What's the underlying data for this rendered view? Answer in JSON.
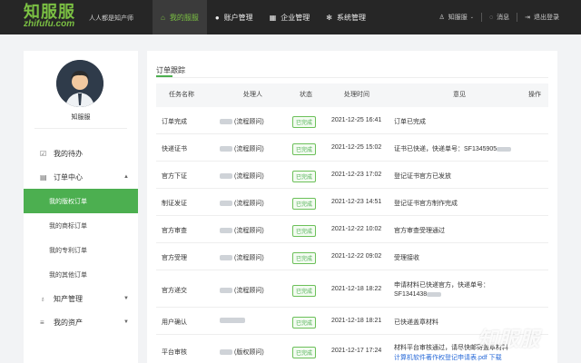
{
  "brand": {
    "logo_big": "知服服",
    "logo_small": "zhifufu.com",
    "slogan": "人人都是知产师"
  },
  "nav": [
    {
      "label": "我的服服",
      "icon": "home-icon",
      "active": true
    },
    {
      "label": "账户管理",
      "icon": "user-icon",
      "active": false
    },
    {
      "label": "企业管理",
      "icon": "building-icon",
      "active": false
    },
    {
      "label": "系统管理",
      "icon": "gear-icon",
      "active": false
    }
  ],
  "topright": {
    "user": "知服服",
    "messages": "消息",
    "logout": "退出登录"
  },
  "sidebar": {
    "username": "知服服",
    "items": [
      {
        "label": "我的待办",
        "icon": "todo-icon"
      },
      {
        "label": "订单中心",
        "icon": "order-icon",
        "expanded": true
      }
    ],
    "subitems": [
      "我的版权订单",
      "我的商标订单",
      "我的专利订单",
      "我的其他订单"
    ],
    "bottom_items": [
      {
        "label": "知产管理",
        "icon": "bulb-icon"
      },
      {
        "label": "我的资产",
        "icon": "database-icon"
      }
    ]
  },
  "main": {
    "title": "订单跟踪",
    "headers": [
      "任务名称",
      "处理人",
      "状态",
      "处理时间",
      "意见",
      "操作"
    ],
    "rows": [
      {
        "task": "订单完成",
        "handler": "(流程顾问)",
        "status": "已完成",
        "time": "2021-12-25 16:41",
        "opinion": "订单已完成",
        "opinion2": "",
        "link": ""
      },
      {
        "task": "快递证书",
        "handler": "(流程顾问)",
        "status": "已完成",
        "time": "2021-12-25 15:02",
        "opinion": "证书已快递，快递单号：SF1345905",
        "opinion2": "",
        "link": ""
      },
      {
        "task": "官方下证",
        "handler": "(流程顾问)",
        "status": "已完成",
        "time": "2021-12-23 17:02",
        "opinion": "登记证书官方已发放",
        "opinion2": "",
        "link": ""
      },
      {
        "task": "制证发证",
        "handler": "(流程顾问)",
        "status": "已完成",
        "time": "2021-12-23 14:51",
        "opinion": "登记证书官方制作完成",
        "opinion2": "",
        "link": ""
      },
      {
        "task": "官方审查",
        "handler": "(流程顾问)",
        "status": "已完成",
        "time": "2021-12-22 10:02",
        "opinion": "官方审查受理通过",
        "opinion2": "",
        "link": ""
      },
      {
        "task": "官方受理",
        "handler": "(流程顾问)",
        "status": "已完成",
        "time": "2021-12-22 09:02",
        "opinion": "受理接收",
        "opinion2": "",
        "link": ""
      },
      {
        "task": "官方递交",
        "handler": "(流程顾问)",
        "status": "已完成",
        "time": "2021-12-18 18:22",
        "opinion": "申请材料已快递官方，快递单号：",
        "opinion2": "SF1341438",
        "link": ""
      },
      {
        "task": "用户确认",
        "handler": "",
        "status": "已完成",
        "time": "2021-12-18 18:21",
        "opinion": "已快递盖章材料",
        "opinion2": "",
        "link": ""
      },
      {
        "task": "平台审核",
        "handler": "(版权顾问)",
        "status": "已完成",
        "time": "2021-12-17 17:24",
        "opinion": "材料平台审核通过，请尽快邮寄盖章材料",
        "opinion2": "",
        "link": "计算机软件著作权登记申请表.pdf 下载"
      }
    ]
  },
  "watermark": "知服服",
  "colors": {
    "accent": "#4caf50",
    "topbar": "#262626",
    "link": "#2a6bd8"
  }
}
